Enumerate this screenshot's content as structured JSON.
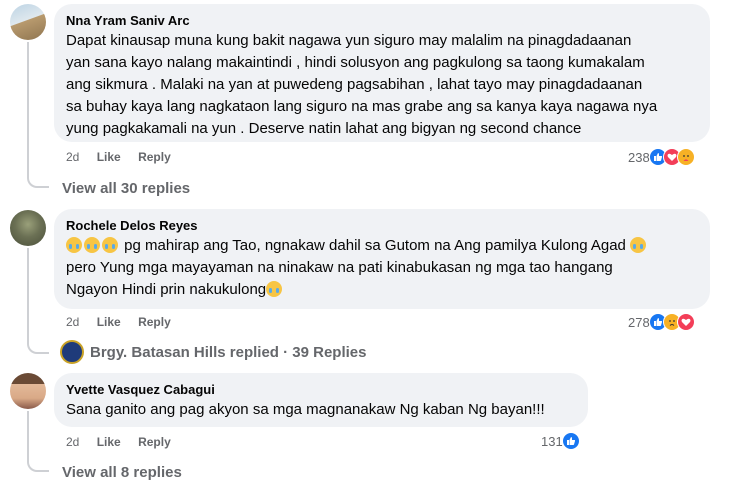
{
  "comments": [
    {
      "author": "Nna Yram Saniv Arc",
      "lines": [
        "Dapat kinausap muna kung bakit nagawa yun siguro may malalim na pinagdadaanan",
        "yan sana kayo nalang makaintindi , hindi solusyon ang pagkulong sa taong kumakalam",
        "ang sikmura . Malaki na yan at puwedeng pagsabihan , lahat tayo may pinagdadaanan",
        "sa buhay kaya lang nagkataon lang siguro na mas grabe ang sa kanya kaya nagawa nya",
        "yung pagkakamali na yun . Deserve natin lahat ang bigyan ng second chance"
      ],
      "time": "2d",
      "like": "Like",
      "reply": "Reply",
      "reaction_count": "238",
      "reactions": [
        "like",
        "love",
        "care"
      ],
      "footer": "View all 30 replies"
    },
    {
      "author": "Rochele Delos Reyes",
      "line1": "pg mahirap ang Tao, ngnakaw dahil sa Gutom na Ang pamilya Kulong Agad",
      "line2": "pero Yung mga mayayaman na ninakaw na pati kinabukasan ng mga tao hangang",
      "line3": "Ngayon Hindi prin nakukulong",
      "time": "2d",
      "like": "Like",
      "reply": "Reply",
      "reaction_count": "278",
      "reactions": [
        "like",
        "sad",
        "love"
      ],
      "footer": "Brgy. Batasan Hills replied · 39 Replies"
    },
    {
      "author": "Yvette Vasquez Cabagui",
      "text": "Sana ganito ang pag akyon sa mga magnanakaw Ng kaban Ng bayan!!!",
      "time": "2d",
      "like": "Like",
      "reply": "Reply",
      "reaction_count": "131",
      "reactions": [
        "like"
      ],
      "footer": "View all 8 replies"
    }
  ],
  "colors": {
    "bubble": "#f0f2f5",
    "meta": "#65676b",
    "like_blue": "#1877f2",
    "love_red": "#f33e58",
    "care_yellow": "#f7b125"
  }
}
